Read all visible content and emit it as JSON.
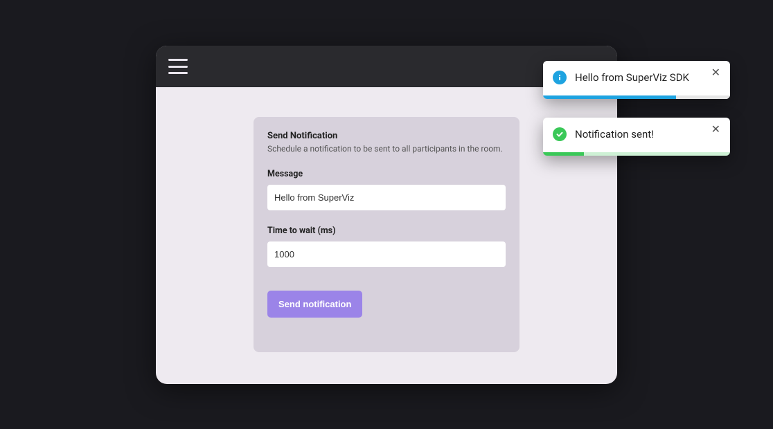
{
  "form": {
    "title": "Send Notification",
    "subtitle": "Schedule a notification to be sent to all participants in the room.",
    "message_label": "Message",
    "message_value": "Hello from SuperViz",
    "time_label": "Time to wait (ms)",
    "time_value": "1000",
    "submit_label": "Send notification"
  },
  "toasts": {
    "info": {
      "text": "Hello from SuperViz SDK",
      "progress_color": "#1ea3e0"
    },
    "success": {
      "text": "Notification sent!",
      "progress_color": "#3ac858"
    }
  }
}
